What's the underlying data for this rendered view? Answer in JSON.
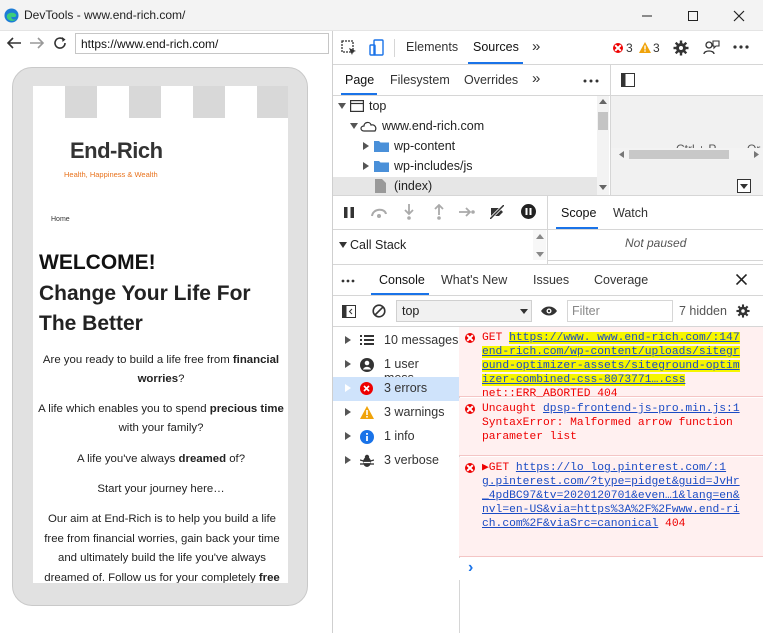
{
  "window": {
    "title": "DevTools - www.end-rich.com/"
  },
  "browser": {
    "url": "https://www.end-rich.com/"
  },
  "site": {
    "logo": "End-Rich",
    "tagline": "Health, Happiness & Wealth",
    "menu_link": "Home",
    "welcome": "WELCOME!",
    "headline": "Change Your Life For The Better",
    "p1_a": "Are you ready to build a life free from ",
    "p1_b": "financial worries",
    "p1_c": "?",
    "p2_a": "A life which enables you to spend ",
    "p2_b": "precious time",
    "p2_c": " with your family?",
    "p3_a": "A life you've always ",
    "p3_b": "dreamed",
    "p3_c": " of?",
    "p4": "Start your journey here…",
    "p5_a": "Our aim at End-Rich is to help you build a life free from financial worries, gain back your time and ultimately build the life you've always dreamed of. Follow us for your completely ",
    "p5_b": "free"
  },
  "devtools": {
    "main_tabs": [
      "Elements",
      "Sources"
    ],
    "more_tabs": "»",
    "error_count": "3",
    "warning_count": "3",
    "sources_tabs": [
      "Page",
      "Filesystem",
      "Overrides"
    ],
    "sources_more": "»",
    "sources_menu": "⋮",
    "tree": {
      "top": "top",
      "domain": "www.end-rich.com",
      "folder1": "wp-content",
      "folder2": "wp-includes/js",
      "file": "(index)"
    },
    "editor_partial_text": "Ctrl + P",
    "editor_partial_text2": "Or",
    "scope_tabs": [
      "Scope",
      "Watch"
    ],
    "call_stack": "Call Stack",
    "not_paused": "Not paused",
    "drawer_tabs": [
      "Console",
      "What's New",
      "Issues",
      "Coverage"
    ],
    "drawer_menu": "⋮",
    "context": "top",
    "filter_placeholder": "Filter",
    "hidden_count": "7 hidden",
    "sidebar": [
      {
        "label": "10 messages",
        "icon": "list-icon"
      },
      {
        "label": "1 user mess…",
        "icon": "user-icon"
      },
      {
        "label": "3 errors",
        "icon": "error-icon"
      },
      {
        "label": "3 warnings",
        "icon": "warning-icon"
      },
      {
        "label": "1 info",
        "icon": "info-icon"
      },
      {
        "label": "3 verbose",
        "icon": "bug-icon"
      }
    ],
    "messages": {
      "m1_prefix": "GET ",
      "m1_url_a": "https://www. www.end-rich.com/:147",
      "m1_url_b": "end-rich.com/wp-content/uploads/sitegr",
      "m1_url_c": "ound-optimizer-assets/siteground-optim",
      "m1_url_d": "izer-combined-css-8073771….css",
      "m1_tail": "net::ERR_ABORTED 404",
      "m2_a": "Uncaught ",
      "m2_link": "dpsp-frontend-js-pro.min.js:1",
      "m2_b": "SyntaxError: Malformed arrow function",
      "m2_c": "parameter list",
      "m3_a": "▶GET ",
      "m3_link_a": "https://lo   log.pinterest.com/:1",
      "m3_link_b": "g.pinterest.com/?type=pidget&guid=JvHr",
      "m3_link_c": "_4pdBC97&tv=2020120701&even…1&lang=en&",
      "m3_link_d": "nvl=en-US&via=https%3A%2F%2Fwww.end-ri",
      "m3_link_e": "ch.com%2F&viaSrc=canonical",
      "m3_status": " 404",
      "prompt": "›"
    }
  },
  "colors": {
    "accent": "#1a73e8",
    "error": "#e00000",
    "warning": "#f0a30a",
    "highlight": "#f6f600",
    "tagline": "#e8731e"
  }
}
